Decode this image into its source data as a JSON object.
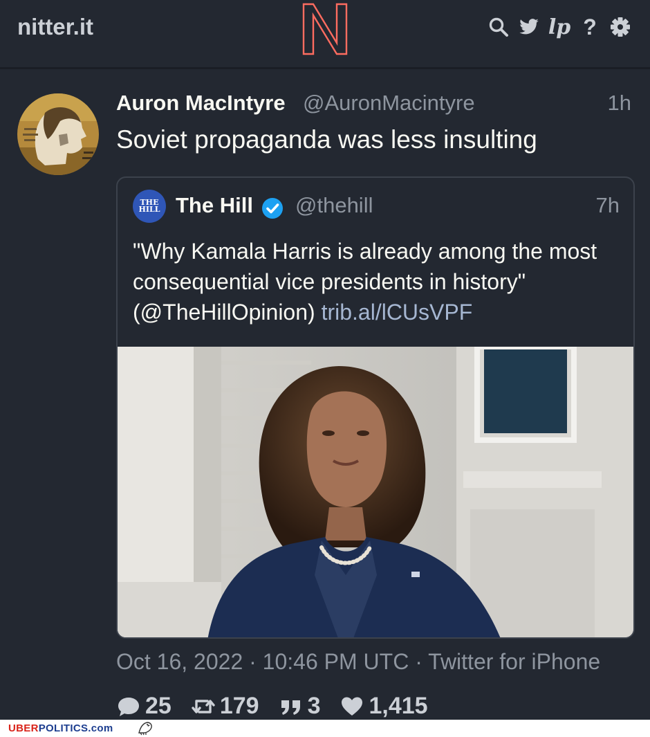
{
  "site": {
    "name": "nitter.it"
  },
  "nav": {
    "icons": [
      "search-icon",
      "twitter-bird-icon",
      "rss-lp-icon",
      "help-icon",
      "settings-gear-icon"
    ],
    "lp_label": "lp",
    "help_label": "?"
  },
  "tweet": {
    "fullname": "Auron MacIntyre",
    "username": "@AuronMacintyre",
    "time": "1h",
    "text": "Soviet propaganda was less insulting",
    "quote": {
      "fullname": "The Hill",
      "username": "@thehill",
      "time": "7h",
      "avatar_text_line1": "THE",
      "avatar_text_line2": "HILL",
      "text_main": "\"Why Kamala Harris is already among the most consequential vice presidents in history\"",
      "text_mention": "(@TheHillOpinion)",
      "text_link": "trib.al/lCUsVPF"
    },
    "date": "Oct 16, 2022 · 10:46 PM UTC · Twitter for iPhone",
    "stats": {
      "replies": "25",
      "retweets": "179",
      "quotes": "3",
      "likes": "1,415"
    }
  },
  "footer": {
    "brand_part1": "UBER",
    "brand_part2": "POLITICS",
    "brand_part3": ".com"
  },
  "colors": {
    "background": "#232831",
    "text": "#f8f8f2",
    "muted": "#8e959f",
    "accent_logo": "#ff6c60",
    "verified": "#1da1f2"
  }
}
